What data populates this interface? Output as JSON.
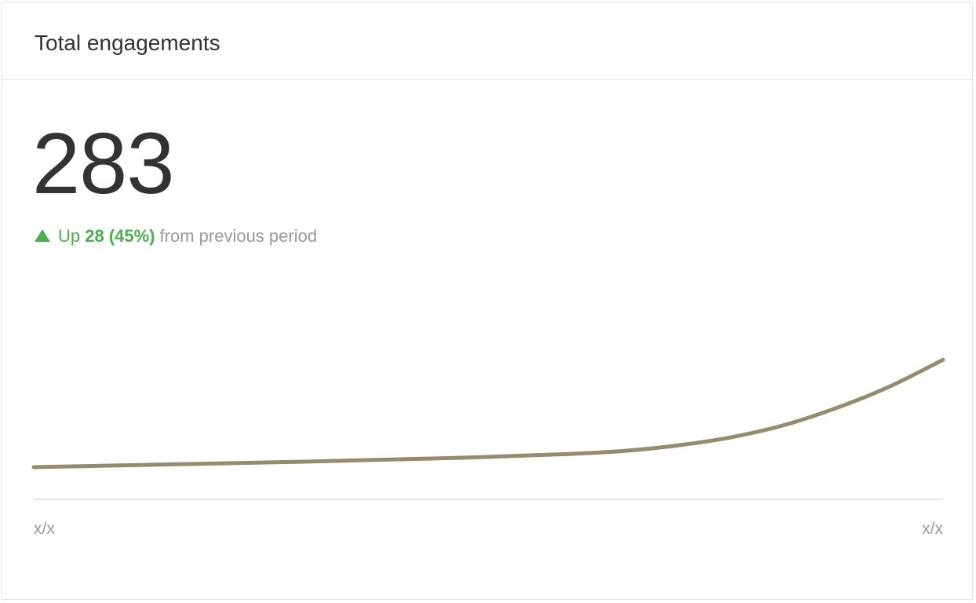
{
  "card": {
    "title": "Total engagements",
    "value": "283",
    "delta": {
      "direction": "up",
      "prefix": "Up ",
      "amount": "28 (45%)",
      "suffix": "from previous period",
      "icon": "triangle-up-icon",
      "color": "#4cae4c"
    }
  },
  "chart_data": {
    "type": "line",
    "x_tick_labels": [
      "x/x",
      "x/x"
    ],
    "series": [
      {
        "color": "#968b6c",
        "values": [
          0.0,
          0.04,
          0.08,
          0.12,
          0.16,
          0.2,
          0.25,
          0.3,
          0.35,
          0.42,
          0.49,
          0.6,
          0.8,
          1.1,
          1.55,
          2.2,
          3.0,
          4.0
        ]
      }
    ],
    "ylim": [
      -1.2,
      6.2
    ],
    "grid": false
  }
}
